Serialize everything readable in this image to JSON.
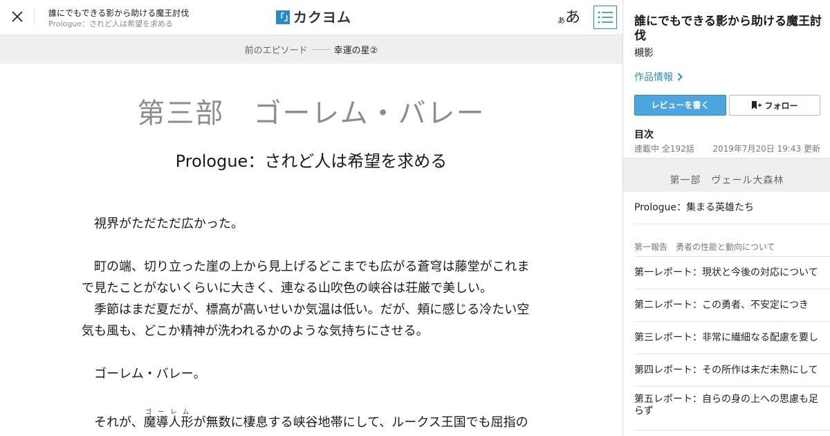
{
  "header": {
    "work_title": "誰にでもできる影から助ける魔王討伐",
    "episode_title": "Prologue：されど人は希望を求める",
    "logo_mark": "「」",
    "logo_text": "カクヨム",
    "font_small": "あ",
    "font_big": "あ",
    "icons": [
      "close-icon",
      "list-icon"
    ]
  },
  "prev_nav": {
    "label": "前のエピソード",
    "title": "幸運の星②"
  },
  "reader": {
    "chapter_title": "第三部　ゴーレム・バレー",
    "episode_title": "Prologue：されど人は希望を求める",
    "paragraphs": [
      "　視界がただただ広かった。",
      "",
      "　町の端、切り立った崖の上から見上げるどこまでも広がる蒼穹は藤堂がこれまで見たことがないくらいに大きく、連なる山吹色の峡谷は荘厳で美しい。",
      "　季節はまだ夏だが、標高が高いせいか気温は低い。だが、頬に感じる冷たい空気も風も、どこか精神が洗われるかのような気持ちにさせる。",
      "",
      "　ゴーレム・バレー。",
      ""
    ],
    "last_para": {
      "before": "　それが、",
      "ruby_base": "魔導人形",
      "ruby_text": "ゴーレム",
      "after": "が無数に棲息する峡谷地帯にして、ルークス王国でも屈指の"
    }
  },
  "side": {
    "work_title": "誰にでもできる影から助ける魔王討伐",
    "author": "槻影",
    "info_link": "作品情報",
    "review_button": "レビューを書く",
    "follow_button": "フォロー",
    "toc_heading": "目次",
    "toc_status": "連載中 全192話",
    "toc_updated": "2019年7月20日 19:43 更新",
    "part_heading": "第一部　ヴェール大森林",
    "items": [
      "Prologue：集まる英雄たち"
    ],
    "section_heading": "第一報告　勇者の性能と動向について",
    "reports": [
      "第一レポート：現状と今後の対応について",
      "第二レポート：この勇者、不安定につき",
      "第三レポート：非常に繊細なる配慮を要し",
      "第四レポート：その所作は未だ未熟にして",
      "第五レポート：自らの身の上への思慮も足らず"
    ],
    "colors": {
      "accent": "#2a8bc9",
      "button_fill": "#4ca5de",
      "bar_bg": "#f0efed"
    }
  }
}
